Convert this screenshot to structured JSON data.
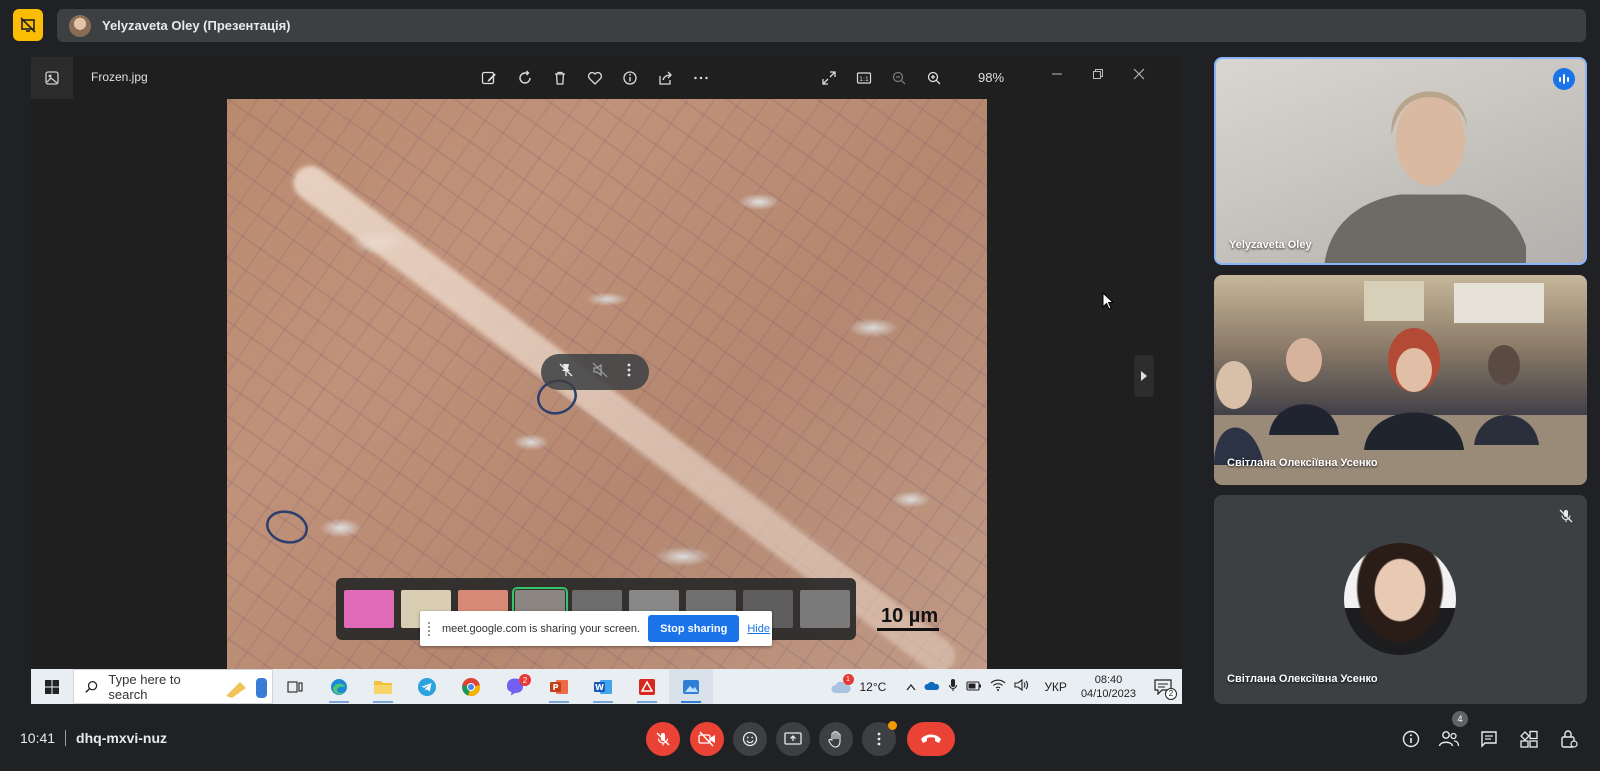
{
  "presenter_bar": {
    "title": "Yelyzaveta Oley (Презентація)"
  },
  "viewer": {
    "filename": "Frozen.jpg",
    "zoom": "98%",
    "toolbar_icons": [
      "edit-icon",
      "rotate-icon",
      "delete-icon",
      "favorite-icon",
      "info-icon",
      "share-icon",
      "more-icon"
    ],
    "scale_label": "10 µm"
  },
  "share_banner": {
    "message": "meet.google.com is sharing your screen.",
    "stop_label": "Stop sharing",
    "hide_label": "Hide"
  },
  "taskbar": {
    "search_placeholder": "Type here to search",
    "weather": "12°C",
    "weather_alert": "1",
    "language": "УКР",
    "time": "08:40",
    "date": "04/10/2023",
    "notifications": "2",
    "viber_badge": "2"
  },
  "participants": [
    {
      "name": "Yelyzaveta Oley",
      "speaking": true
    },
    {
      "name": "Світлана Олексіївна Усенко"
    },
    {
      "name": "Світлана Олексіївна Усенко",
      "muted": true
    }
  ],
  "meeting": {
    "time": "10:41",
    "code": "dhq-mxvi-nuz",
    "participant_count": "4"
  },
  "colors": {
    "accent": "#1a73e8",
    "danger": "#ea4335",
    "present_badge": "#fbbc04",
    "background": "#202124"
  }
}
